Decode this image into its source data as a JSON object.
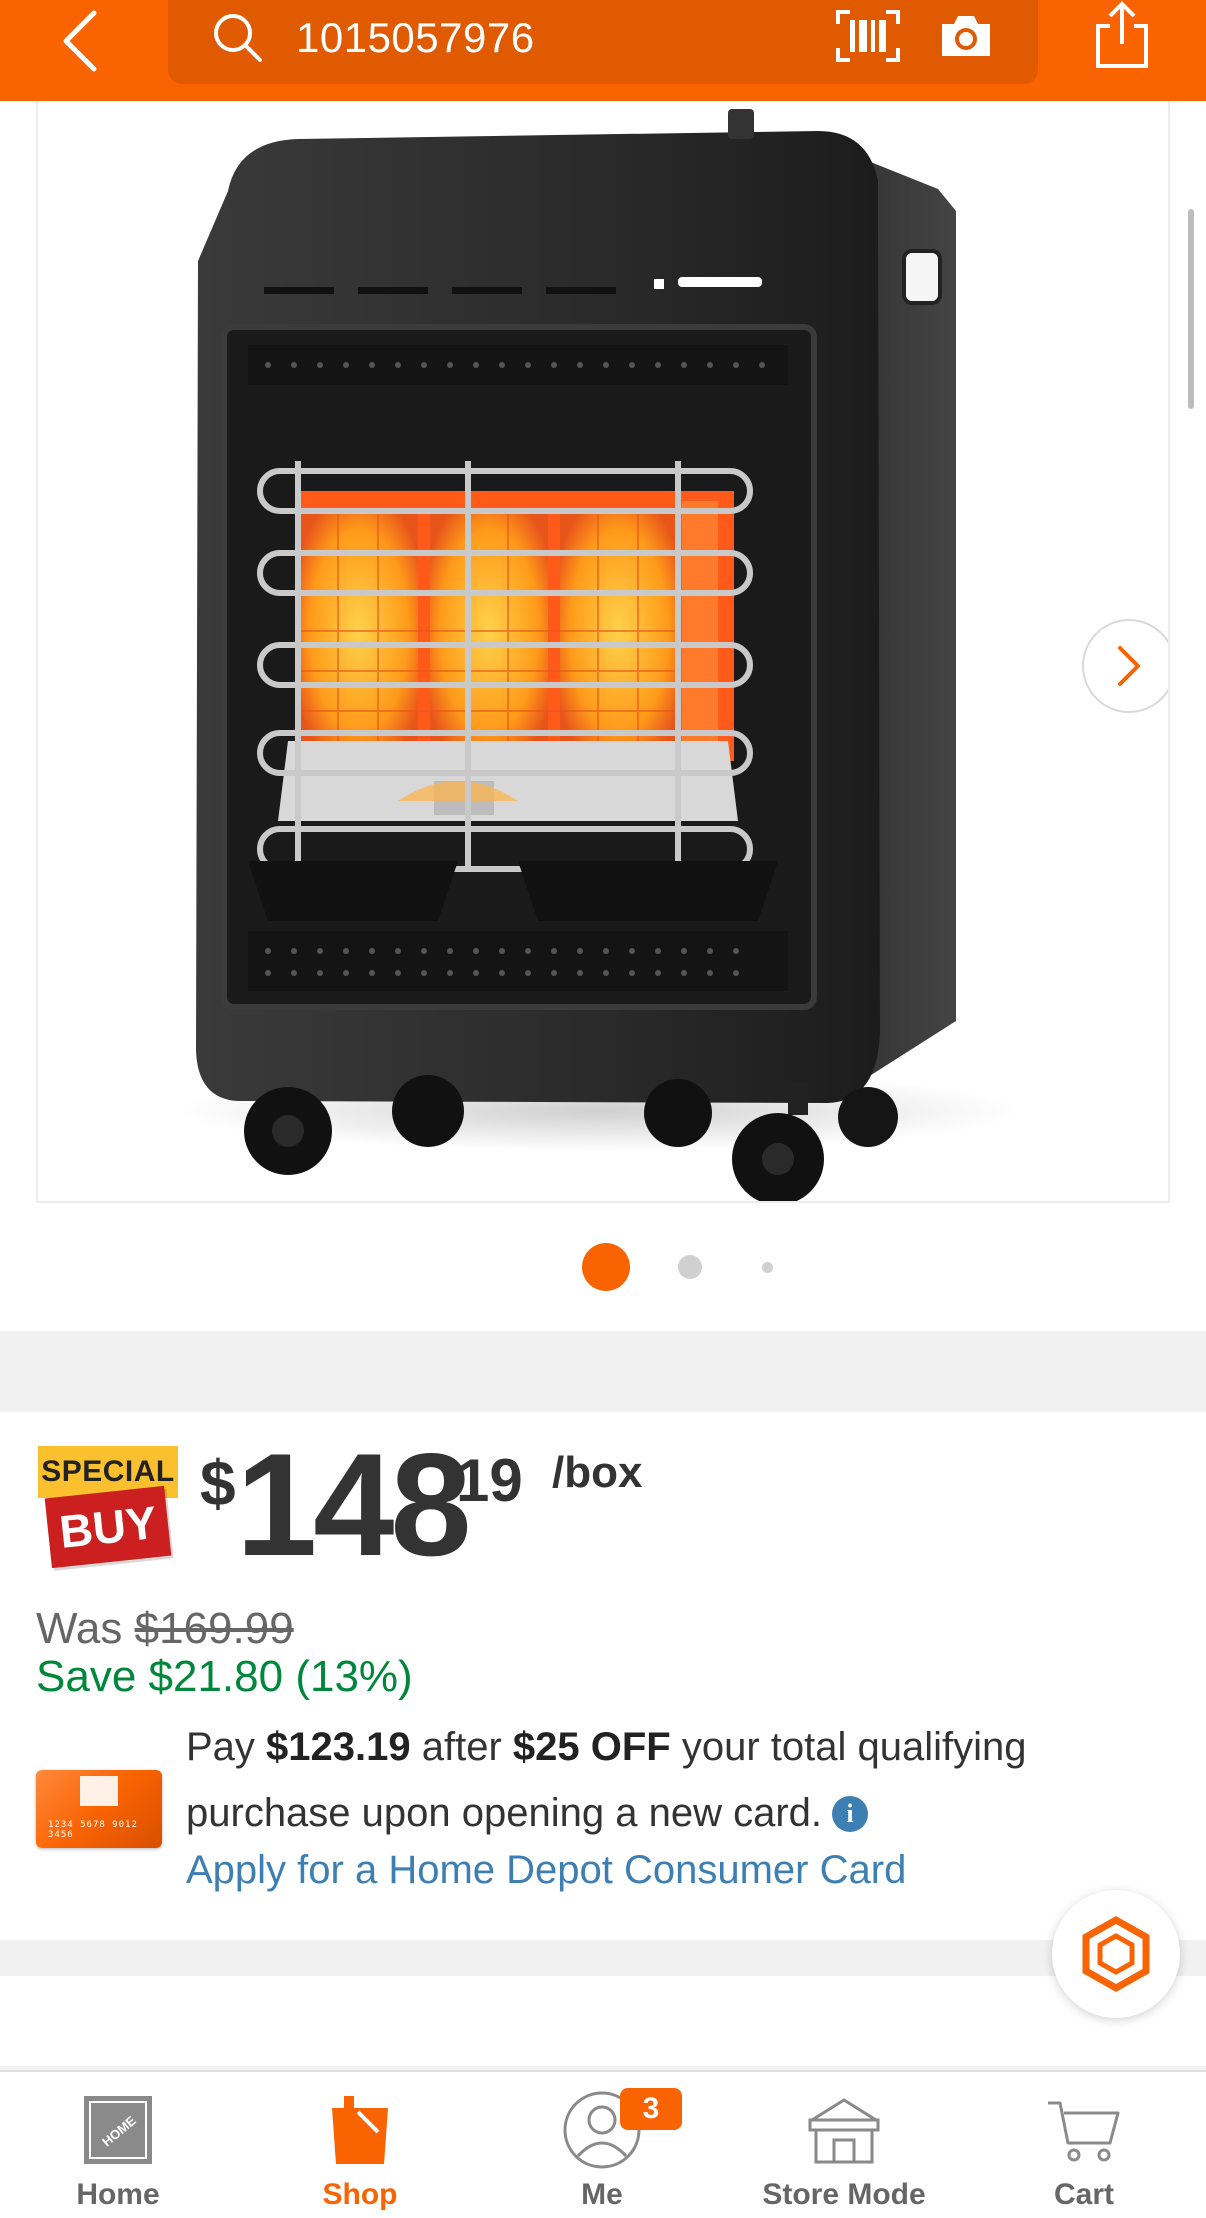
{
  "header": {
    "search_query": "1015057976",
    "icons": [
      "back-icon",
      "search-icon",
      "barcode-icon",
      "camera-icon",
      "share-icon"
    ]
  },
  "gallery": {
    "image_count": 3,
    "active_index": 1,
    "next_icon": "chevron-right-icon"
  },
  "price": {
    "badge_top": "SPECIAL",
    "badge_bottom": "BUY",
    "currency": "$",
    "dollars": "148",
    "cents": "19",
    "unit": "/box",
    "was_label": "Was",
    "was_price": "$169.99",
    "save_text": "Save $21.80 (13%)"
  },
  "card_offer": {
    "text_1": "Pay ",
    "amount": "$123.19",
    "text_2": " after ",
    "discount": "$25 OFF",
    "text_3": " your total qualifying purchase upon opening a new card.",
    "apply_link": "Apply for a Home Depot Consumer Card"
  },
  "bottom_nav": {
    "items": [
      {
        "label": "Home",
        "icon": "home-depot-logo-icon"
      },
      {
        "label": "Shop",
        "icon": "shop-bucket-icon",
        "active": true
      },
      {
        "label": "Me",
        "icon": "user-icon",
        "badge": "3"
      },
      {
        "label": "Store Mode",
        "icon": "store-icon"
      },
      {
        "label": "Cart",
        "icon": "cart-icon"
      }
    ]
  },
  "colors": {
    "brand_orange": "#f96302",
    "save_green": "#00873c",
    "link_blue": "#3e7fb3"
  }
}
